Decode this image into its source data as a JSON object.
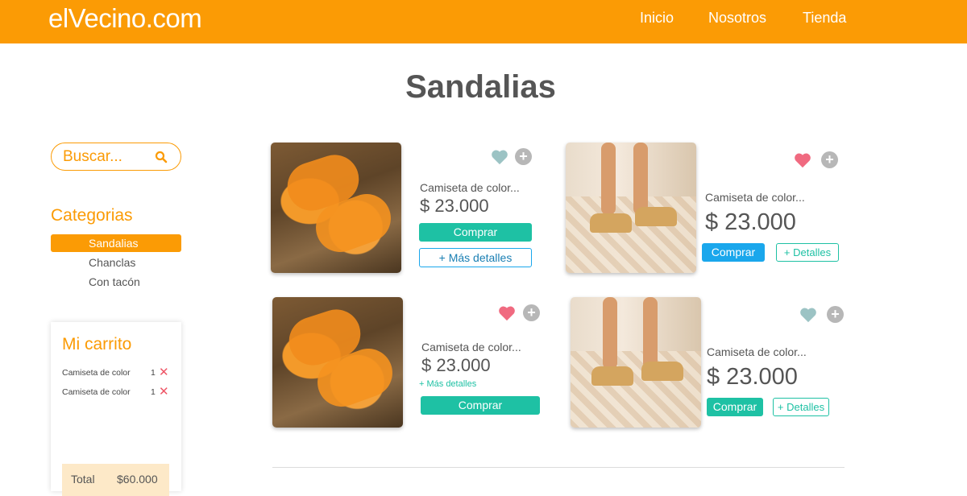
{
  "header": {
    "logo": "elVecino.com",
    "nav": [
      "Inicio",
      "Nosotros",
      "Tienda"
    ]
  },
  "page_title": "Sandalias",
  "search": {
    "placeholder": "Buscar..."
  },
  "categories": {
    "title": "Categorias",
    "items": [
      "Sandalias",
      "Chanclas",
      "Con tacón"
    ],
    "active": "Sandalias"
  },
  "cart": {
    "title": "Mi carrito",
    "items": [
      {
        "name": "Camiseta de color",
        "qty": "1"
      },
      {
        "name": "Camiseta de color",
        "qty": "1"
      }
    ],
    "total_label": "Total",
    "total_value": "$60.000"
  },
  "products": [
    {
      "name": "Camiseta de color...",
      "price": "$ 23.000",
      "buy": "Comprar",
      "details": "+ Más detalles",
      "favorite": false
    },
    {
      "name": "Camiseta de color...",
      "price": "$ 23.000",
      "buy": "Comprar",
      "details": "+ Detalles",
      "favorite": true
    },
    {
      "name": "Camiseta de color...",
      "price": "$ 23.000",
      "buy": "Comprar",
      "details": "+ Más detalles",
      "favorite": true
    },
    {
      "name": "Camiseta de color...",
      "price": "$ 23.000",
      "buy": "Comprar",
      "details": "+ Detalles",
      "favorite": false
    }
  ],
  "colors": {
    "brand": "#fb9b05",
    "teal": "#1ec1a4",
    "blue": "#1aa7ec",
    "heart_active": "#f06a80",
    "heart_inactive": "#9cc3c4"
  },
  "icons": {
    "search": "search-icon",
    "favorite": "heart-icon",
    "add": "plus-circle-icon",
    "remove": "close-icon"
  }
}
